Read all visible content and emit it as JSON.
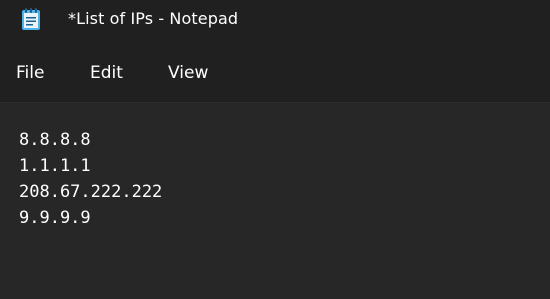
{
  "window": {
    "title": "*List of IPs - Notepad"
  },
  "menu": {
    "items": [
      {
        "label": "File"
      },
      {
        "label": "Edit"
      },
      {
        "label": "View"
      }
    ]
  },
  "editor": {
    "lines": [
      "8.8.8.8",
      "1.1.1.1",
      "208.67.222.222",
      "9.9.9.9"
    ]
  },
  "icons": {
    "app": "notepad-icon"
  },
  "colors": {
    "titlebar_bg": "#202020",
    "editor_bg": "#272727",
    "text": "#ffffff",
    "icon_accent": "#4fb3e8"
  }
}
